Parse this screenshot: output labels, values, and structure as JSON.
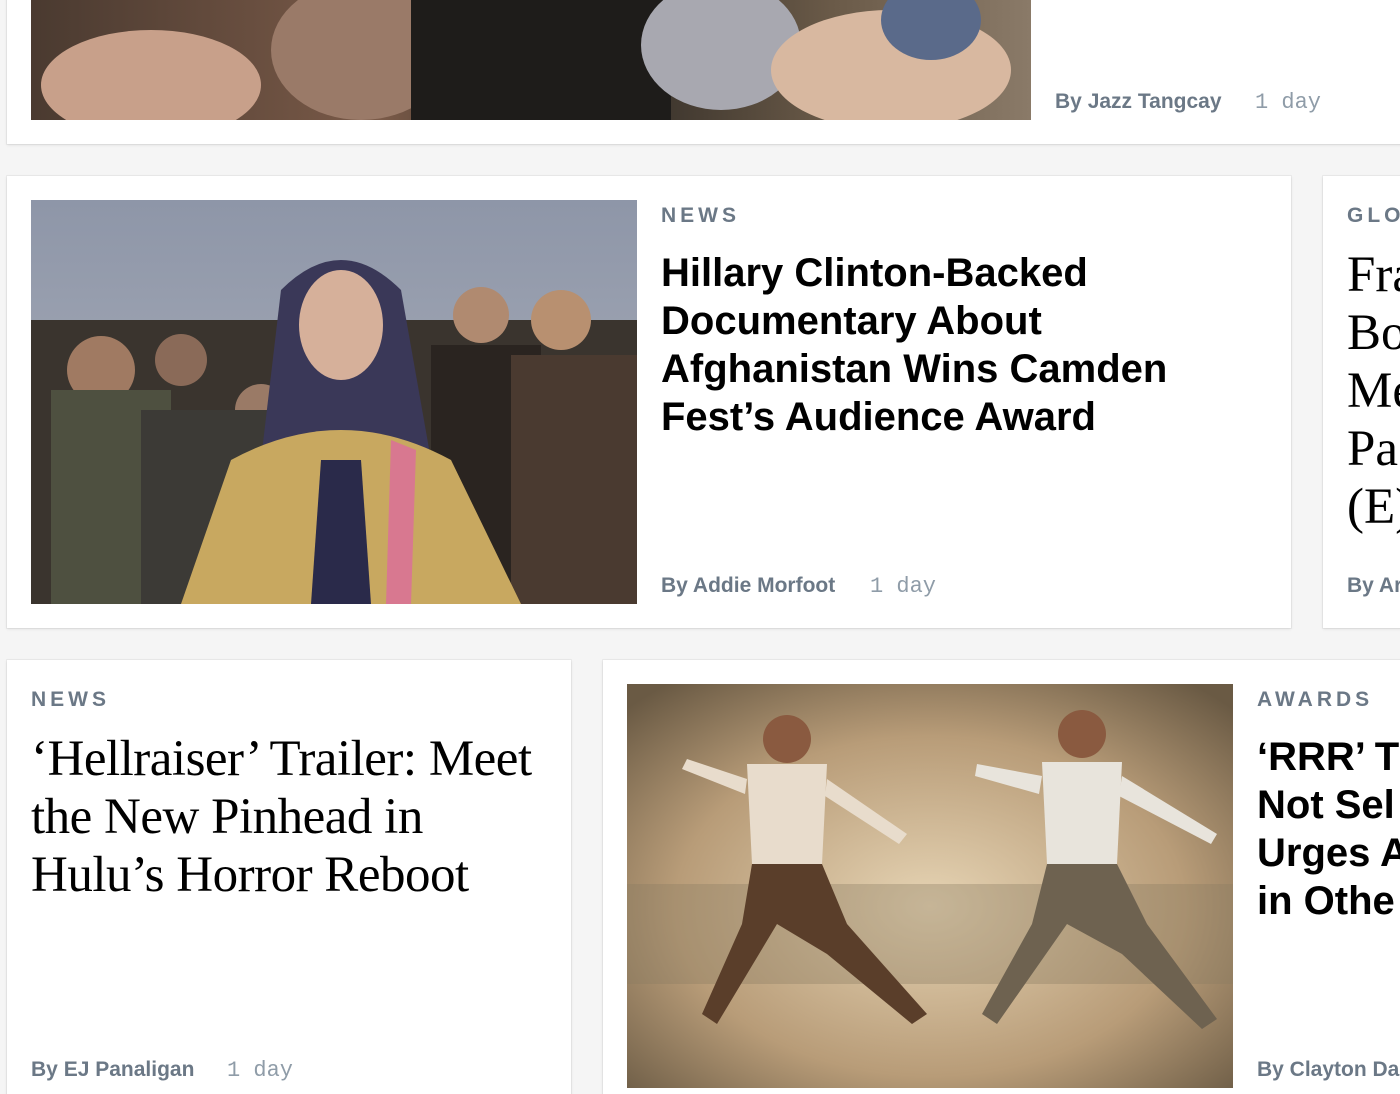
{
  "top_card": {
    "byline_prefix": "By",
    "author": "Jazz Tangcay",
    "time": "1 day"
  },
  "card_afghanistan": {
    "category": "NEWS",
    "headline": "Hillary Clinton-Backed Documentary About Afghanistan Wins Camden Fest’s Audience Award",
    "byline_prefix": "By",
    "author": "Addie Morfoot",
    "time": "1 day"
  },
  "card_global_partial": {
    "category": "GLO",
    "headline_lines": [
      "Fra",
      "Bo",
      "Me",
      "Pa",
      "(E)"
    ],
    "byline": "By Ar"
  },
  "card_hellraiser": {
    "category": "NEWS",
    "headline": "‘Hellraiser’ Trailer: Meet the New Pinhead in Hulu’s Horror Reboot",
    "byline_prefix": "By",
    "author": "EJ Panaligan",
    "time": "1 day"
  },
  "card_rrr": {
    "category": "AWARDS",
    "headline_lines": [
      "‘RRR’ T",
      "Not Sel",
      "Urges A",
      "in Othe"
    ],
    "byline": "By Clayton Da"
  },
  "colors": {
    "eyebrow": "#6b7886",
    "byline": "#6b7886",
    "time": "#8f9ca8",
    "headline": "#000000",
    "card_bg": "#ffffff",
    "page_bg": "#f5f5f5"
  }
}
